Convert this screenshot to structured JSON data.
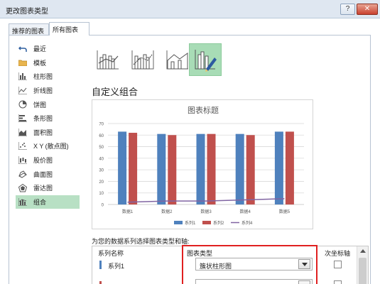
{
  "window": {
    "title": "更改图表类型",
    "help_glyph": "?",
    "close_glyph": "✕"
  },
  "tabs": [
    {
      "label": "推荐的图表"
    },
    {
      "label": "所有图表"
    }
  ],
  "sidebar": {
    "items": [
      {
        "label": "最近",
        "icon": "undo-arrow-icon"
      },
      {
        "label": "模板",
        "icon": "folder-icon"
      },
      {
        "label": "柱形图",
        "icon": "column-chart-icon"
      },
      {
        "label": "折线图",
        "icon": "line-chart-icon"
      },
      {
        "label": "饼图",
        "icon": "pie-chart-icon"
      },
      {
        "label": "条形图",
        "icon": "bar-chart-icon"
      },
      {
        "label": "面积图",
        "icon": "area-chart-icon"
      },
      {
        "label": "X Y (散点图)",
        "icon": "scatter-chart-icon"
      },
      {
        "label": "股价图",
        "icon": "stock-chart-icon"
      },
      {
        "label": "曲面图",
        "icon": "surface-chart-icon"
      },
      {
        "label": "雷达图",
        "icon": "radar-chart-icon"
      },
      {
        "label": "组合",
        "icon": "combo-chart-icon"
      }
    ],
    "selected_index": 11
  },
  "chart_subtypes": [
    {
      "icon": "clustered-column-line-icon"
    },
    {
      "icon": "clustered-column-line-secondary-icon"
    },
    {
      "icon": "stacked-area-column-icon"
    },
    {
      "icon": "custom-combination-icon"
    }
  ],
  "section_title": "自定义组合",
  "chart_data": {
    "type": "bar",
    "title": "图表标题",
    "categories": [
      "数据1",
      "数据2",
      "数据3",
      "数据4",
      "数据5"
    ],
    "series": [
      {
        "name": "系列1",
        "kind": "bar",
        "color": "#4f81bd",
        "values": [
          63,
          61,
          61,
          61,
          63
        ]
      },
      {
        "name": "系列2",
        "kind": "bar",
        "color": "#c0504d",
        "values": [
          62,
          60,
          61,
          60,
          63
        ]
      },
      {
        "name": "系列4",
        "kind": "line",
        "color": "#8064a2",
        "values": [
          2,
          3,
          3,
          4,
          5
        ]
      }
    ],
    "yticks": [
      0,
      10,
      20,
      30,
      40,
      50,
      60,
      70
    ],
    "ylim": [
      0,
      70
    ],
    "grid": true,
    "legend_position": "bottom"
  },
  "assign_label": "为您的数据系列选择图表类型和轴:",
  "grid": {
    "headers": {
      "name": "系列名称",
      "type": "图表类型",
      "axis": "次坐标轴"
    },
    "rows": [
      {
        "name": "系列1",
        "type": "簇状柱形图",
        "marker_color": "#4f81bd",
        "secondary": false
      },
      {
        "name": "",
        "type": "",
        "marker_color": "#c0504d",
        "secondary": false
      }
    ]
  },
  "colors": {
    "accent_selected": "#a8dcb6",
    "highlight": "#e02020"
  }
}
